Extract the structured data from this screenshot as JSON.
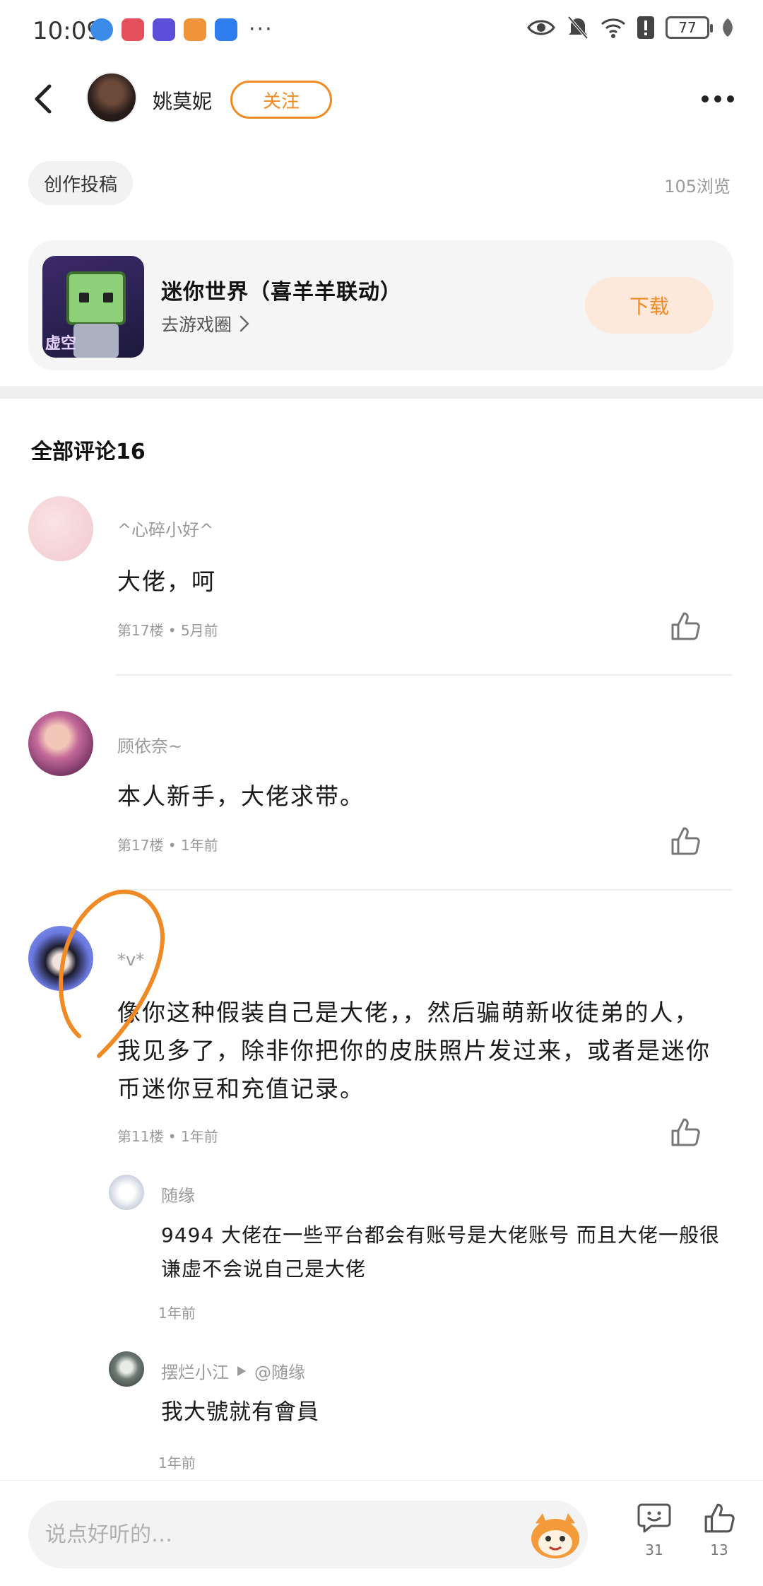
{
  "status_bar": {
    "time": "10:09",
    "more": "···",
    "battery": "77"
  },
  "header": {
    "author_name": "姚莫妮",
    "follow_label": "关注"
  },
  "post": {
    "tag": "创作投稿",
    "views": "105浏览"
  },
  "game_card": {
    "title": "迷你世界（喜羊羊联动）",
    "subtitle": "去游戏圈",
    "download_label": "下载",
    "icon_text": "虚空"
  },
  "comments_section": {
    "title": "全部评论16",
    "comments": [
      {
        "name": "^心碎小好^",
        "text": "大佬，呵",
        "meta": "第17楼 • 5月前"
      },
      {
        "name": "顾依奈~",
        "text": "本人新手，大佬求带。",
        "meta": "第17楼 • 1年前"
      },
      {
        "name": "*v*",
        "text": "像你这种假装自己是大佬，，然后骗萌新收徒弟的人，我见多了，除非你把你的皮肤照片发过来，或者是迷你币迷你豆和充值记录。",
        "meta": "第11楼 • 1年前"
      }
    ],
    "replies": [
      {
        "name": "随缘",
        "text": "9494  大佬在一些平台都会有账号是大佬账号  而且大佬一般很谦虚不会说自己是大佬",
        "meta": "1年前"
      },
      {
        "name": "摆烂小江",
        "reply_to": "@随缘",
        "text": "我大號就有會員",
        "meta": "1年前"
      }
    ]
  },
  "bottom_bar": {
    "input_placeholder": "说点好听的…",
    "comment_count": "31",
    "like_count": "13"
  }
}
